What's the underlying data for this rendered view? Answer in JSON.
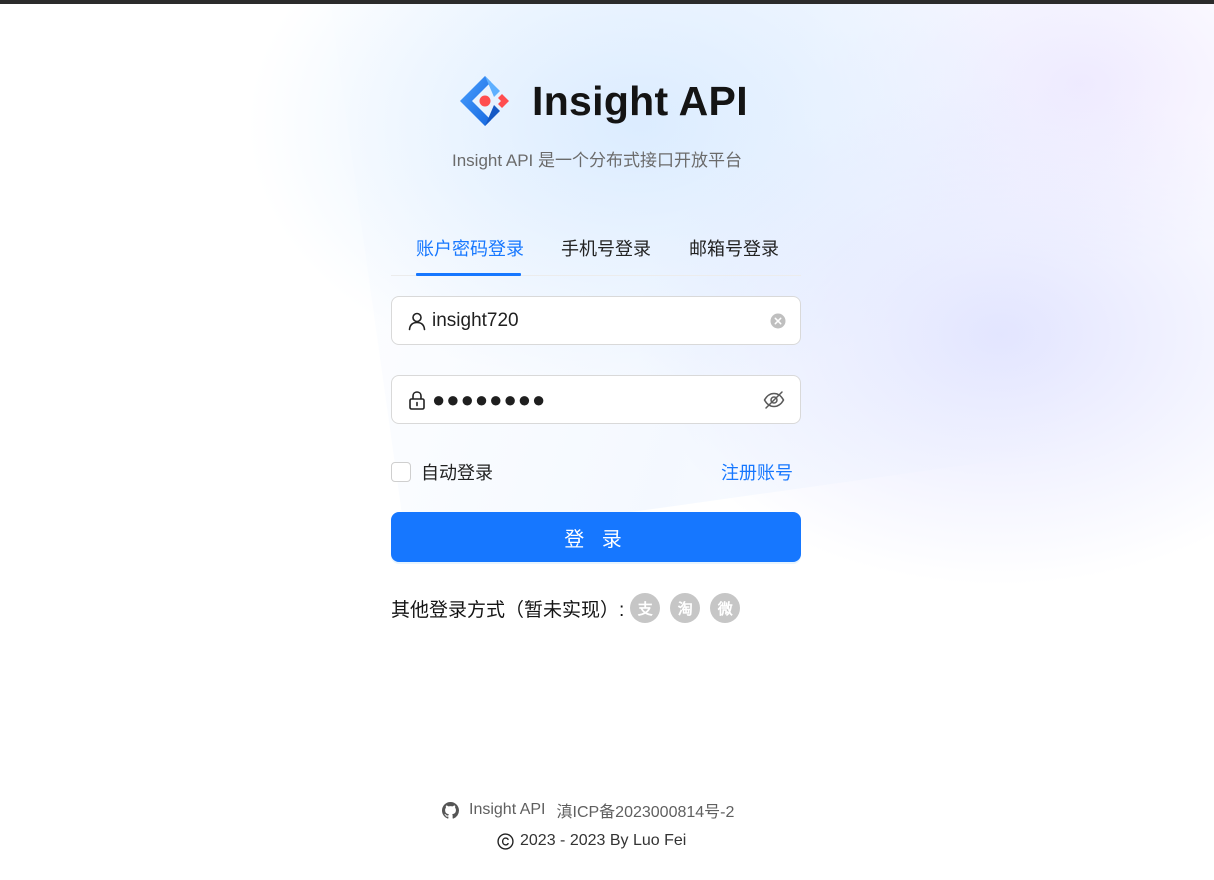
{
  "brand": {
    "title": "Insight API",
    "subtitle": "Insight API 是一个分布式接口开放平台"
  },
  "tabs": [
    {
      "label": "账户密码登录",
      "active": true
    },
    {
      "label": "手机号登录",
      "active": false
    },
    {
      "label": "邮箱号登录",
      "active": false
    }
  ],
  "form": {
    "username_value": "insight720",
    "password_value": "●●●●●●●●",
    "remember_label": "自动登录",
    "register_label": "注册账号",
    "submit_label": "登 录"
  },
  "other_login": {
    "label": "其他登录方式（暂未实现）:",
    "providers": [
      {
        "name": "alipay",
        "glyph": "支"
      },
      {
        "name": "taobao",
        "glyph": "淘"
      },
      {
        "name": "weibo",
        "glyph": "微"
      }
    ]
  },
  "footer": {
    "site_link": "Insight API",
    "icp": "滇ICP备2023000814号-2",
    "copyright": "2023 - 2023 By Luo Fei"
  },
  "colors": {
    "primary": "#1677ff",
    "logo_blue": "#1677ff",
    "logo_red": "#ff4d4f",
    "social_gray": "#c6c6c6"
  },
  "icons": [
    "app-logo-icon",
    "user-icon",
    "clear-icon",
    "lock-icon",
    "eye-invisible-icon",
    "alipay-icon",
    "taobao-icon",
    "weibo-icon",
    "github-icon",
    "copyright-icon"
  ]
}
